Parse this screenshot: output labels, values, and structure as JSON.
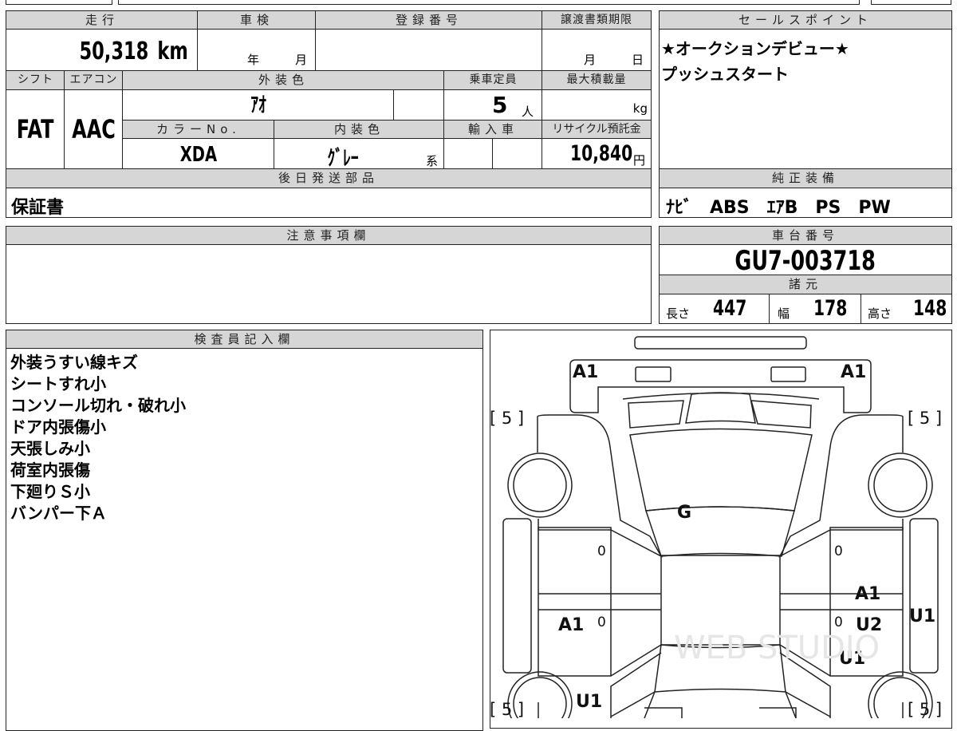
{
  "top_table": {
    "mileage_label": "走行",
    "mileage_value": "50,318",
    "mileage_unit": "km",
    "inspection_label": "車検",
    "inspection_year": "年",
    "inspection_month": "月",
    "registration_label": "登録番号",
    "registration_value": "",
    "transfer_deadline_label": "譲渡書類期限",
    "transfer_month": "月",
    "transfer_day": "日",
    "shift_label": "シフト",
    "shift_value": "FAT",
    "aircon_label": "エアコン",
    "aircon_value": "AAC",
    "exterior_color_label": "外装色",
    "exterior_color_value": "ｱｵ",
    "capacity_label": "乗車定員",
    "capacity_value": "5",
    "capacity_unit": "人",
    "max_load_label": "最大積載量",
    "max_load_unit": "kg",
    "color_no_label": "カラーNo.",
    "color_no_value": "XDA",
    "interior_color_label": "内装色",
    "interior_color_value": "ｸﾞﾚｰ",
    "interior_color_suffix": "系",
    "import_label": "輸入車",
    "recycle_label": "リサイクル預託金",
    "recycle_value": "10,840",
    "recycle_unit": "円",
    "later_parts_label": "後日発送部品",
    "later_parts_value": "保証書"
  },
  "sales_point": {
    "label": "セールスポイント",
    "lines": [
      "★オークションデビュー★",
      "プッシュスタート"
    ]
  },
  "equipment": {
    "label": "純正装備",
    "value": "ﾅﾋﾞ　ABS　ｴｱB　PS　PW"
  },
  "notes": {
    "label": "注意事項欄",
    "value": ""
  },
  "chassis": {
    "label": "車台番号",
    "value": "GU7-003718",
    "specs_label": "諸元",
    "length_label": "長さ",
    "length_value": "447",
    "width_label": "幅",
    "width_value": "178",
    "height_label": "高さ",
    "height_value": "148"
  },
  "inspector": {
    "label": "検査員記入欄",
    "lines": [
      "外装うすい線キズ",
      "シートすれ小",
      "コンソール切れ・破れ小",
      "ドア内張傷小",
      "天張しみ小",
      "荷室内張傷",
      "下廻りＳ小",
      "バンパー下Ａ"
    ]
  },
  "diagram": {
    "marks": {
      "front_left": "A1",
      "front_right": "A1",
      "tire_fl": "[ 5 ]",
      "tire_fr": "[ 5 ]",
      "tire_rl": "[ 5 ]",
      "tire_rr": "[ 5 ]",
      "windshield": "G",
      "door_fl": "0",
      "door_fr": "0",
      "door_rl": "0",
      "door_rr": "0",
      "rear_door_right_1": "A1",
      "rear_door_right_2": "U2",
      "side_right": "U1",
      "rear_door_left": "A1",
      "rear_fender_right": "U1",
      "rear_fender_left": "U1"
    },
    "watermark": "WEB STUDIO"
  }
}
